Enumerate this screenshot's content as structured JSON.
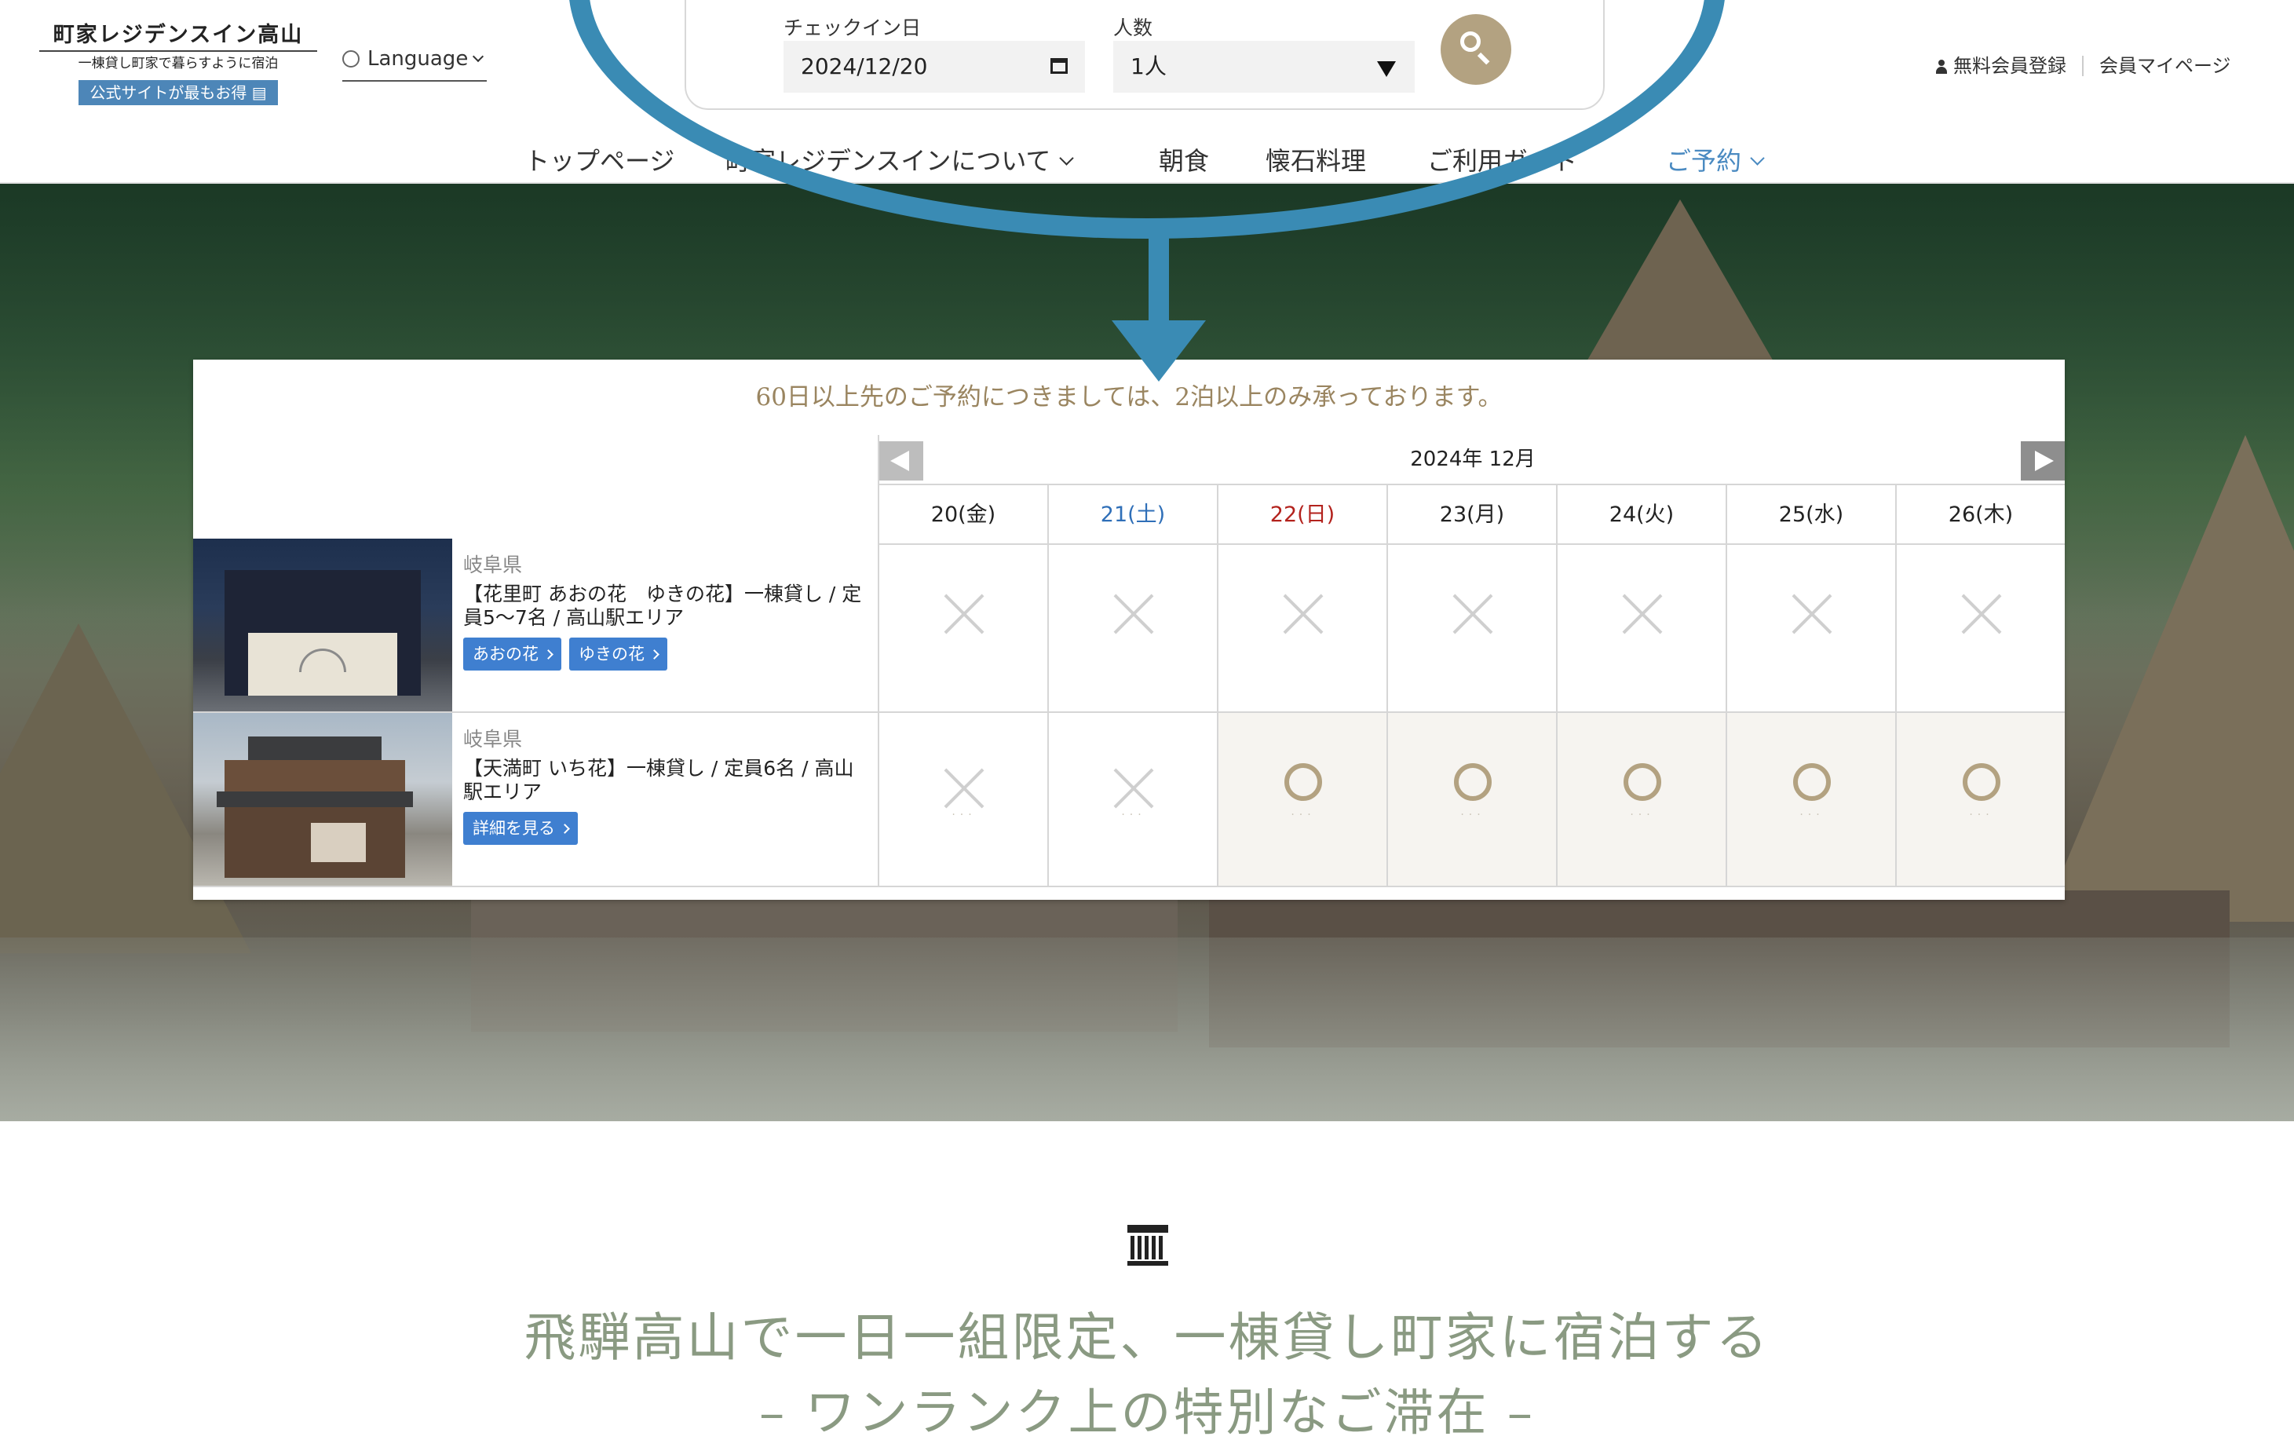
{
  "header": {
    "logo_title": "町家レジデンスイン高山",
    "logo_sub": "一棟貸し町家で暮らすように宿泊",
    "logo_badge": "公式サイトが最もお得",
    "language": "Language",
    "checkin_label": "チェックイン日",
    "checkin_value": "2024/12/20",
    "guests_label": "人数",
    "guests_value": "1人",
    "register": "無料会員登録",
    "mypage": "会員マイページ"
  },
  "nav": {
    "top": "トップページ",
    "about": "町家レジデンスインについて",
    "breakfast": "朝食",
    "kaiseki": "懐石料理",
    "guide": "ご利用ガイド",
    "reserve": "ご予約"
  },
  "calendar": {
    "notice": "60日以上先のご予約につきましては、2泊以上のみ承っております。",
    "month": "2024年 12月",
    "days": [
      "20(金)",
      "21(土)",
      "22(日)",
      "23(月)",
      "24(火)",
      "25(水)",
      "26(木)"
    ],
    "rooms": [
      {
        "pref": "岐阜県",
        "name": "【花里町 あおの花　ゆきの花】一棟貸し / 定員5〜7名 / 高山駅エリア",
        "buttons": [
          "あおの花",
          "ゆきの花"
        ],
        "availability": [
          "x",
          "x",
          "x",
          "x",
          "x",
          "x",
          "x"
        ]
      },
      {
        "pref": "岐阜県",
        "name": "【天満町 いち花】一棟貸し / 定員6名 / 高山駅エリア",
        "buttons": [
          "詳細を見る"
        ],
        "availability": [
          "x",
          "x",
          "o",
          "o",
          "o",
          "o",
          "o"
        ]
      }
    ]
  },
  "bottom": {
    "headline": "飛騨高山で一日一組限定、一棟貸し町家に宿泊する",
    "subline": "– ワンランク上の特別なご滞在 –"
  },
  "colors": {
    "overlay_blue": "#3a8bb4",
    "accent_gold": "#b3a281",
    "button_blue": "#3f7fd0",
    "headline_green": "#8a9a82"
  },
  "icons": {
    "search": "search-icon",
    "calendar": "calendar-icon",
    "globe": "globe-icon",
    "person": "person-icon",
    "machiya": "machiya-house-icon"
  }
}
